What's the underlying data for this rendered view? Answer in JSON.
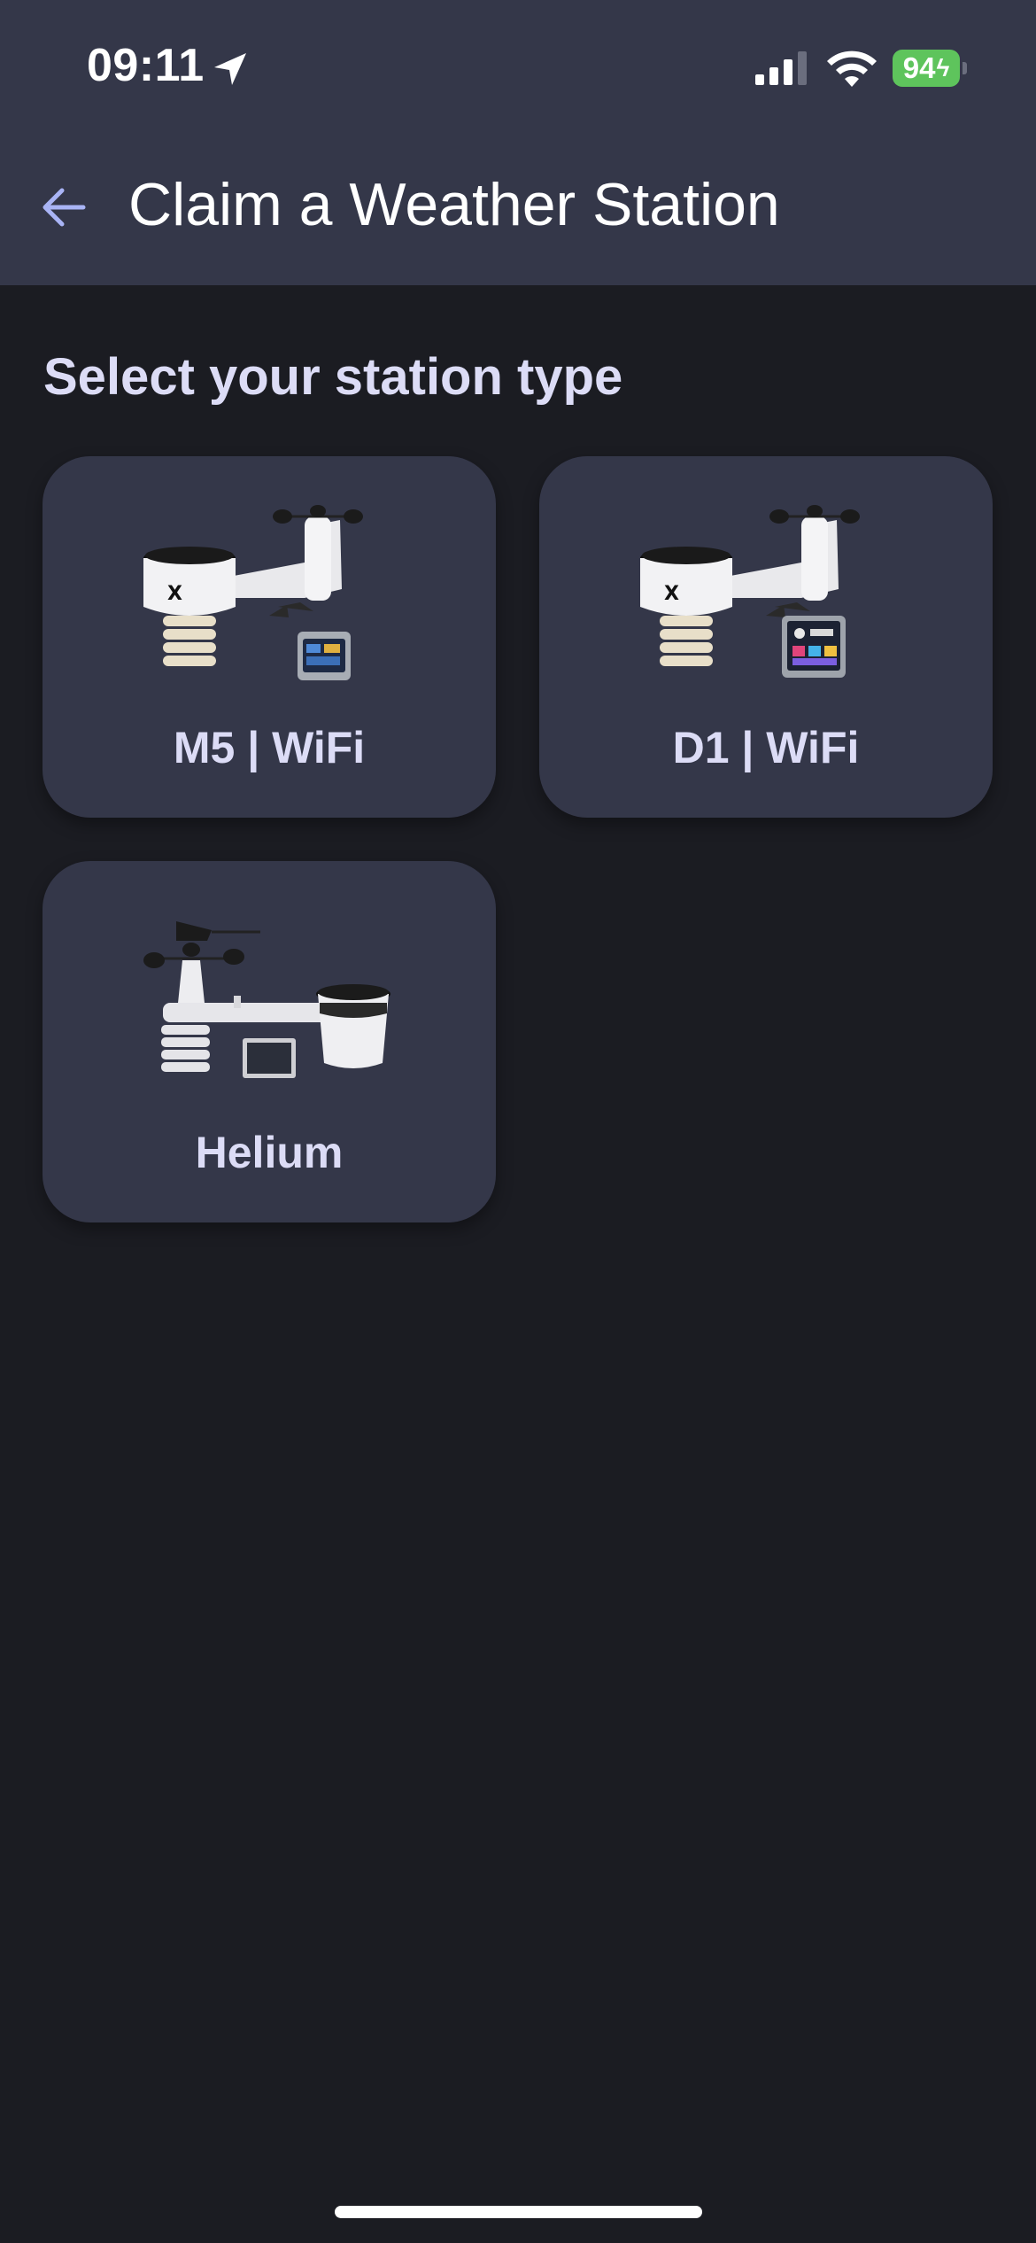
{
  "status_bar": {
    "time": "09:11",
    "battery_level": "94",
    "battery_color": "#5ec45c",
    "icons": [
      "location-arrow-icon",
      "cellular-signal-icon",
      "wifi-icon",
      "battery-charging-icon"
    ]
  },
  "header": {
    "title": "Claim a Weather Station",
    "back_icon": "arrow-left-icon",
    "background": "#343749",
    "accent": "#a9b4f5"
  },
  "content": {
    "section_title": "Select your station type",
    "background": "#1b1c22",
    "station_types": [
      {
        "label": "M5 | WiFi",
        "image": "weather-station-with-small-display"
      },
      {
        "label": "D1 | WiFi",
        "image": "weather-station-with-color-display"
      },
      {
        "label": "Helium",
        "image": "weather-station-with-solar-panel"
      }
    ]
  }
}
